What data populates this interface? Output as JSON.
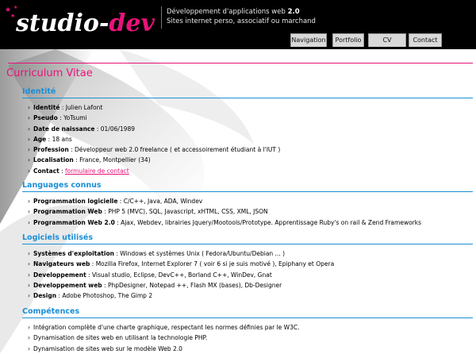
{
  "header": {
    "logo_text_a": "studio-",
    "logo_text_b": "dev",
    "tagline_line1_text": "Développement d'applications web",
    "tagline_line1_bold": "2.0",
    "tagline_line2": "Sites internet perso, associatif ou marchand"
  },
  "nav": {
    "items": [
      "Navigation",
      "Portfolio",
      "CV",
      "Contact"
    ]
  },
  "colors": {
    "accent_pink": "#e8137a",
    "accent_blue": "#1a8fd6",
    "header_bg": "#000000"
  },
  "page": {
    "title": "Curriculum Vitae"
  },
  "identite": {
    "heading": "Identité",
    "items": [
      {
        "label": "Identité",
        "value": "Julien Lafont"
      },
      {
        "label": "Pseudo",
        "value": "YoTsumi"
      },
      {
        "label": "Date de naissance",
        "value": "01/06/1989"
      },
      {
        "label": "Age",
        "value": "18 ans"
      },
      {
        "label": "Profession",
        "value": "Développeur web 2.0 freelance ( et accessoirement étudiant à l'IUT )"
      },
      {
        "label": "Localisation",
        "value": "France, Montpellier (34)"
      },
      {
        "label": "Contact",
        "link": "formulaire de contact"
      }
    ]
  },
  "langages": {
    "heading": "Languages connus",
    "items": [
      {
        "label": "Programmation logicielle",
        "value": "C/C++, Java, ADA, Windev"
      },
      {
        "label": "Programmation Web",
        "value": "PHP 5 (MVC), SQL, Javascript, xHTML, CSS, XML, JSON"
      },
      {
        "label": "Programmation Web 2.0",
        "value": "Ajax, Webdev, librairies Jquery/Mootools/Prototype. Apprentissage Ruby's on rail & Zend Frameworks"
      }
    ]
  },
  "logiciels": {
    "heading": "Logiciels utilisés",
    "items": [
      {
        "label": "Systèmes d'exploitation",
        "value": "Windows et systèmes Unix ( Fedora/Ubuntu/Debian ... )"
      },
      {
        "label": "Navigateurs web",
        "value": "Mozilla Firefox, Internet Explorer 7 ( voir 6 si je suis motivé ), Epiphany et Opera"
      },
      {
        "label": "Developpement",
        "value": "Visual studio, Eclipse, DevC++, Borland C++, WinDev, Gnat"
      },
      {
        "label": "Developpement web",
        "value": "PhpDesigner, Notepad ++, Flash MX (bases), Db-Designer"
      },
      {
        "label": "Design",
        "value": "Adobe Photoshop, The Gimp 2"
      }
    ]
  },
  "competences": {
    "heading": "Compétences",
    "items": [
      "Intégration complète d'une charte graphique, respectant les normes définies par le W3C.",
      "Dynamisation de sites web en utilisant la technologie PHP.",
      "Dynamisation de sites web sur le modèle Web 2.0"
    ]
  }
}
